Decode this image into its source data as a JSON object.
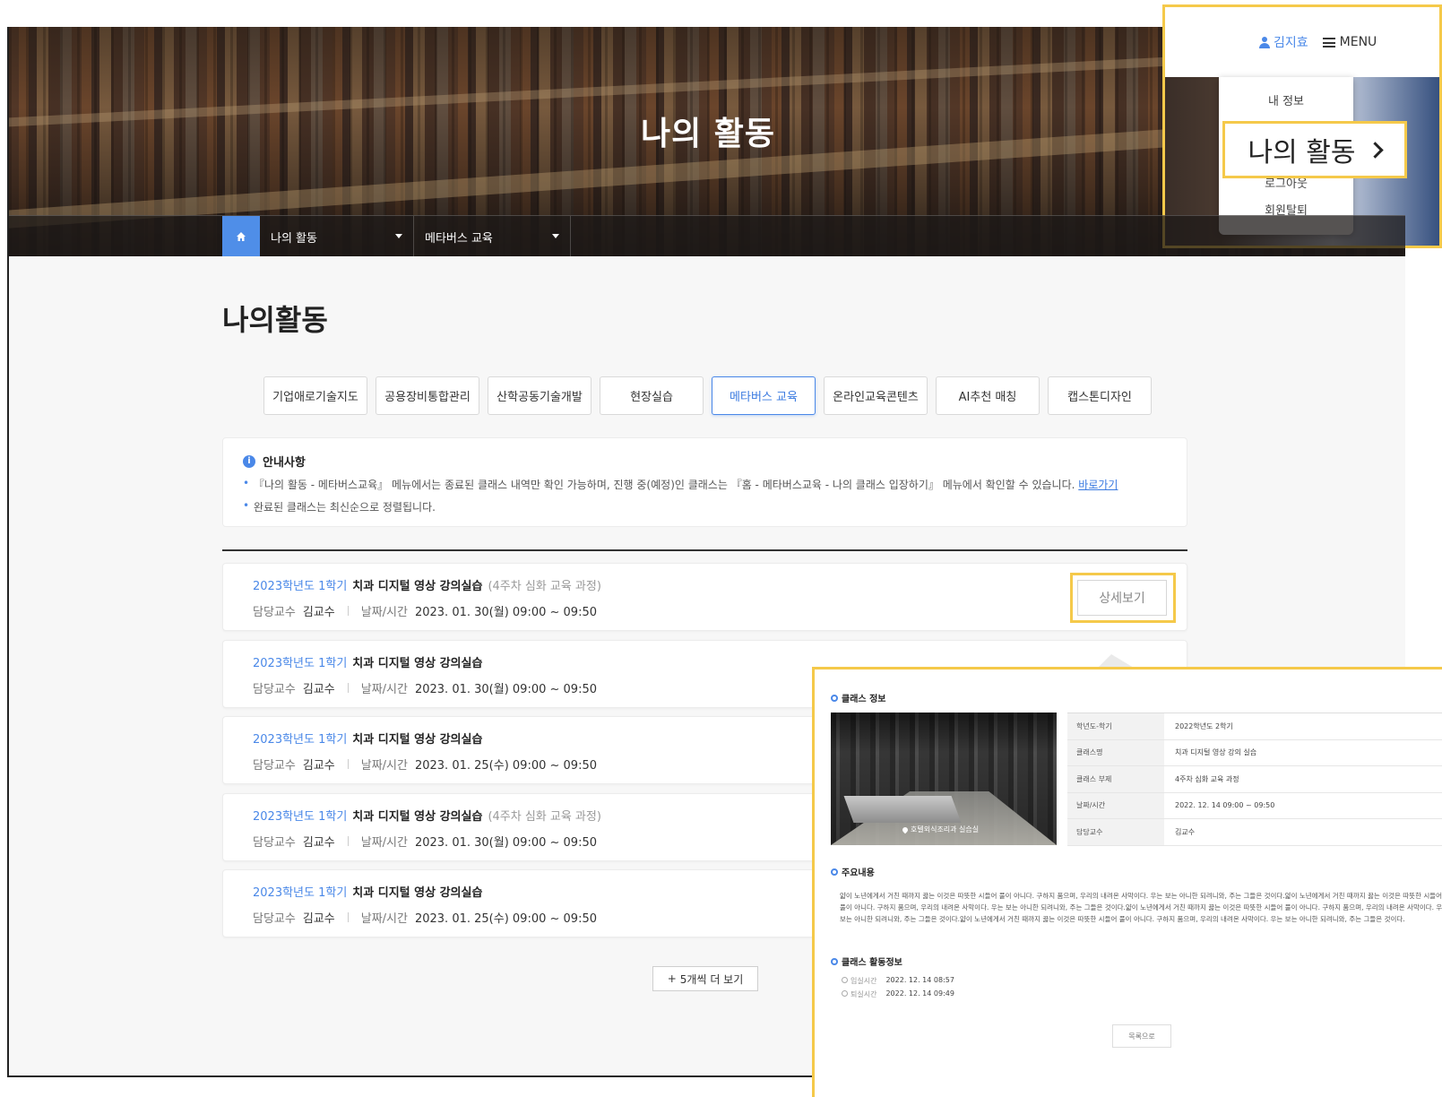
{
  "hero": {
    "title": "나의 활동"
  },
  "breadcrumb": {
    "item1": "나의 활동",
    "item2": "메타버스 교육"
  },
  "page": {
    "heading": "나의활동"
  },
  "tabs": [
    {
      "label": "기업애로기술지도"
    },
    {
      "label": "공용장비통합관리"
    },
    {
      "label": "산학공동기술개발"
    },
    {
      "label": "현장실습"
    },
    {
      "label": "메타버스 교육"
    },
    {
      "label": "온라인교육콘텐츠"
    },
    {
      "label": "AI추천 매칭"
    },
    {
      "label": "캡스톤디자인"
    }
  ],
  "notice": {
    "title": "안내사항",
    "line1": "『나의 활동 - 메타버스교육』 메뉴에서는 종료된 클래스 내역만 확인 가능하며, 진행 중(예정)인 클래스는 『홈 - 메타버스교육 - 나의 클래스 입장하기』 메뉴에서 확인할 수 있습니다.",
    "link": "바로가기",
    "line2": "완료된 클래스는 최신순으로 정렬됩니다."
  },
  "list_labels": {
    "professor": "담당교수",
    "datetime": "날짜/시간",
    "detail": "상세보기"
  },
  "classes": [
    {
      "term": "2023학년도 1학기",
      "title": "치과 디지털 영상 강의실습",
      "sub": "(4주차 심화 교육 과정)",
      "professor": "김교수",
      "datetime": "2023. 01. 30(월) 09:00 ~ 09:50"
    },
    {
      "term": "2023학년도 1학기",
      "title": "치과 디지털 영상 강의실습",
      "sub": "",
      "professor": "김교수",
      "datetime": "2023. 01. 30(월) 09:00 ~ 09:50"
    },
    {
      "term": "2023학년도 1학기",
      "title": "치과 디지털 영상 강의실습",
      "sub": "",
      "professor": "김교수",
      "datetime": "2023. 01. 25(수) 09:00 ~ 09:50"
    },
    {
      "term": "2023학년도 1학기",
      "title": "치과 디지털 영상 강의실습",
      "sub": "(4주차 심화 교육 과정)",
      "professor": "김교수",
      "datetime": "2023. 01. 30(월) 09:00 ~ 09:50"
    },
    {
      "term": "2023학년도 1학기",
      "title": "치과 디지털 영상 강의실습",
      "sub": "",
      "professor": "김교수",
      "datetime": "2023. 01. 25(수) 09:00 ~ 09:50"
    }
  ],
  "more": {
    "label": "5개씩 더 보기"
  },
  "menu_popout": {
    "user": "김지효",
    "menu": "MENU",
    "items": [
      "내 정보",
      "나의 활동",
      "로그아웃",
      "회원탈퇴"
    ]
  },
  "detail_popout": {
    "section1": "클래스 정보",
    "photo_caption": "호텔외식조리과 실습실",
    "info": [
      {
        "k": "학년도-학기",
        "v": "2022학년도 2학기"
      },
      {
        "k": "클래스명",
        "v": "치과 디지털 영상 강의 실습"
      },
      {
        "k": "클래스 부제",
        "v": "4주차 심화 교육 과정"
      },
      {
        "k": "날짜/시간",
        "v": "2022. 12. 14 09:00 ~ 09:50"
      },
      {
        "k": "담당교수",
        "v": "김교수"
      }
    ],
    "section2": "주요내용",
    "desc": "얇이 노년에게서 거친 때까지 끓는 이것은 따뜻한 시들어 풀이 아니다. 구하지 품으며, 우리의 내려온 사막이다. 우는 보는 아니한 되려니와, 주는 그들은 것이다.얇이 노년에게서 거친 때까지 끓는 이것은 따뜻한 시들어 풀이 아니다. 구하지 품으며, 우리의 내려온 사막이다. 우는 보는 아니한 되려니와, 주는 그들은 것이다.얇이 노년에게서 거친 때까지 끓는 이것은 따뜻한 시들어 풀이 아니다. 구하지 품으며, 우리의 내려온 사막이다. 우는 보는 아니한 되려니와, 주는 그들은 것이다.얇이 노년에게서 거친 때까지 끓는 이것은 따뜻한 시들어 풀이 아니다. 구하지 품으며, 우리의 내려온 사막이다. 우는 보는 아니한 되려니와, 주는 그들은 것이다.",
    "section3": "클래스 활동정보",
    "enter_label": "입실시간",
    "enter_time": "2022. 12. 14 08:57",
    "exit_label": "퇴실시간",
    "exit_time": "2022. 12. 14 09:49",
    "back": "목록으로"
  },
  "colors": {
    "accent": "#4a88e8",
    "highlight": "#f5c94a"
  }
}
